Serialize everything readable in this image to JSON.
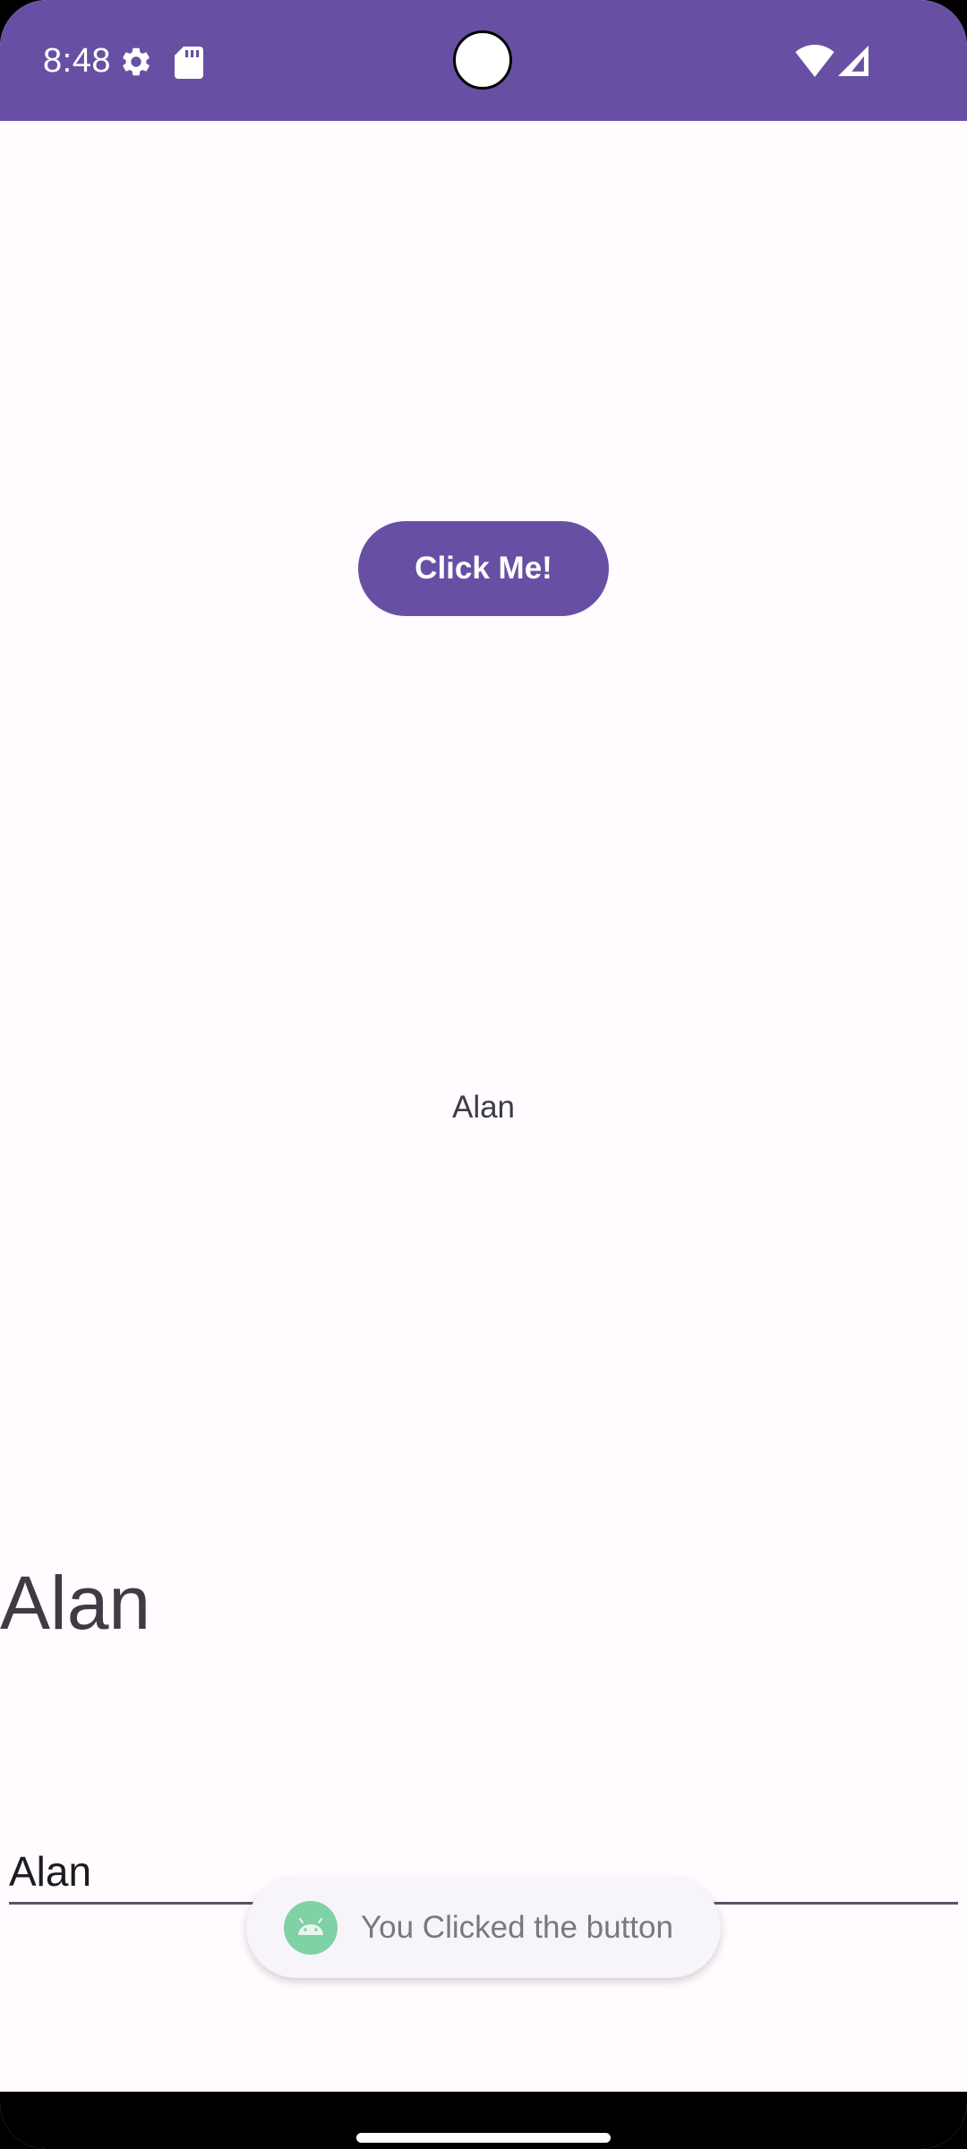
{
  "status_bar": {
    "time": "8:48",
    "background_color": "#6750A4",
    "icons": [
      "gear-icon",
      "sd-card-icon",
      "wifi-icon",
      "signal-icon"
    ]
  },
  "main": {
    "button_label": "Click Me!",
    "center_text": "Alan",
    "large_text": "Alan",
    "input_value": "Alan"
  },
  "toast": {
    "message": "You Clicked the button",
    "icon": "android-icon"
  },
  "colors": {
    "accent": "#6750A4",
    "background": "#FFFBFE"
  }
}
